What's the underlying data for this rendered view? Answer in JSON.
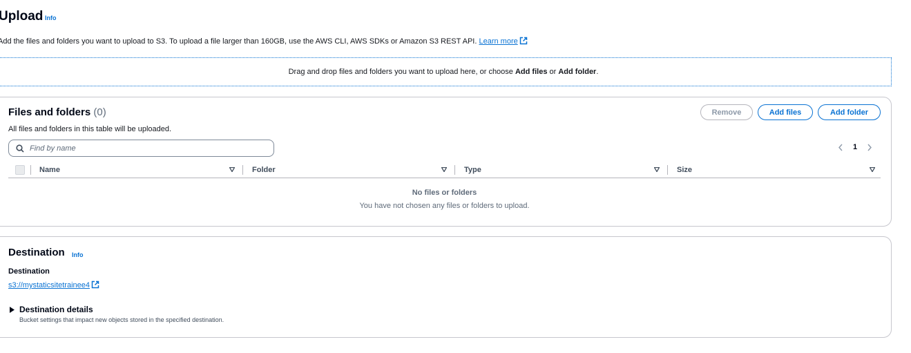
{
  "header": {
    "title": "Upload",
    "info_label": "Info",
    "description": "Add the files and folders you want to upload to S3. To upload a file larger than 160GB, use the AWS CLI, AWS SDKs or Amazon S3 REST API.",
    "learn_more": "Learn more"
  },
  "drop_zone": {
    "text_prefix": "Drag and drop files and folders you want to upload here, or choose",
    "add_files": "Add files",
    "or": "or",
    "add_folder": "Add folder",
    "suffix": "."
  },
  "files": {
    "title": "Files and folders",
    "count": "(0)",
    "description": "All files and folders in this table will be uploaded.",
    "remove_label": "Remove",
    "add_files_label": "Add files",
    "add_folder_label": "Add folder",
    "search_placeholder": "Find by name",
    "page_number": "1",
    "columns": [
      "Name",
      "Folder",
      "Type",
      "Size"
    ],
    "empty_title": "No files or folders",
    "empty_desc": "You have not chosen any files or folders to upload."
  },
  "destination": {
    "title": "Destination",
    "info_label": "Info",
    "label": "Destination",
    "link": "s3://mystaticsitetrainee4",
    "details_label": "Destination details",
    "details_desc": "Bucket settings that impact new objects stored in the specified destination."
  },
  "colors": {
    "link": "#0972d3",
    "border": "#c6c6cd",
    "text": "#16191f"
  }
}
